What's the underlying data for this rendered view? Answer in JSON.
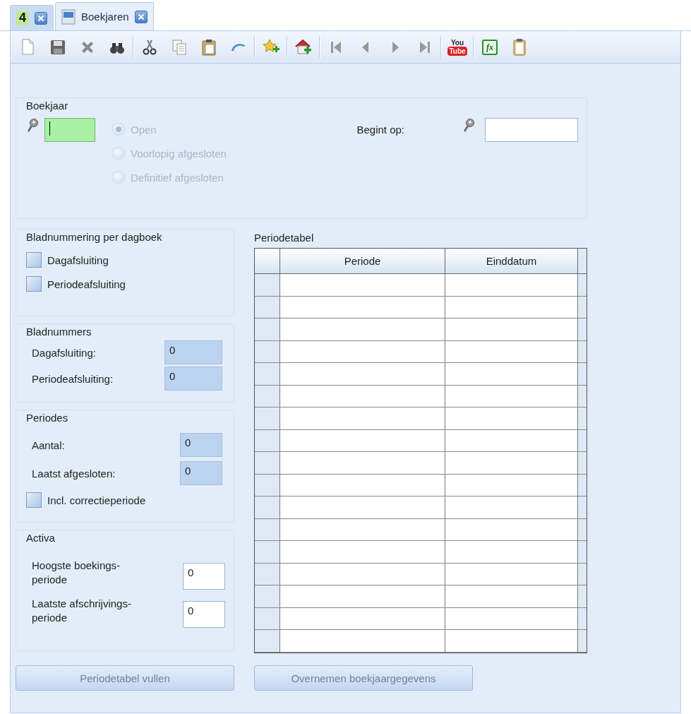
{
  "tabs": [
    {
      "kind": "home",
      "icon_text": "4",
      "selected": false
    },
    {
      "kind": "document",
      "label": "Boekjaren",
      "selected": true
    }
  ],
  "toolbar": [
    {
      "kind": "new"
    },
    {
      "kind": "save"
    },
    {
      "kind": "delete"
    },
    {
      "kind": "find"
    },
    {
      "kind": "separator"
    },
    {
      "kind": "cut"
    },
    {
      "kind": "copy"
    },
    {
      "kind": "paste"
    },
    {
      "kind": "undo"
    },
    {
      "kind": "separator"
    },
    {
      "kind": "favorite"
    },
    {
      "kind": "separator"
    },
    {
      "kind": "home-add"
    },
    {
      "kind": "separator"
    },
    {
      "kind": "first"
    },
    {
      "kind": "previous"
    },
    {
      "kind": "next"
    },
    {
      "kind": "last"
    },
    {
      "kind": "separator"
    },
    {
      "kind": "video",
      "top_text": "You",
      "bottom_text": "Tube"
    },
    {
      "kind": "separator"
    },
    {
      "kind": "spreadsheet",
      "glyph": "fx"
    },
    {
      "kind": "clipboard"
    }
  ],
  "boekjaar": {
    "title": "Boekjaar",
    "year_field": {
      "focused": true
    },
    "status_options": [
      {
        "label": "Open",
        "selected": true,
        "disabled": true
      },
      {
        "label": "Voorlopig afgesloten",
        "selected": false,
        "disabled": true
      },
      {
        "label": "Definitief afgesloten",
        "selected": false,
        "disabled": true
      }
    ],
    "start_label": "Begint op:",
    "start_field": {
      "focused": false
    }
  },
  "bladnummering": {
    "title": "Bladnummering per dagboek",
    "options": [
      {
        "label": "Dagafsluiting",
        "checked": false
      },
      {
        "label": "Periodeafsluiting",
        "checked": false
      }
    ]
  },
  "bladnummers": {
    "title": "Bladnummers",
    "fields": [
      {
        "label": "Dagafsluiting:",
        "value": "0",
        "readonly": true
      },
      {
        "label": "Periodeafsluiting:",
        "value": "0",
        "readonly": true
      }
    ]
  },
  "periodes": {
    "title": "Periodes",
    "fields": [
      {
        "label": "Aantal:",
        "value": "0",
        "readonly": true
      },
      {
        "label": "Laatst afgesloten:",
        "value": "0",
        "readonly": true
      }
    ],
    "option": {
      "label": "Incl. correctieperiode",
      "checked": false
    }
  },
  "activa": {
    "title": "Activa",
    "fields": [
      {
        "label": "Hoogste boekings-\nperiode",
        "value": "0",
        "readonly": false
      },
      {
        "label": "Laatste afschrijvings-\nperiode",
        "value": "0",
        "readonly": false
      }
    ]
  },
  "periodetabel": {
    "title": "Periodetabel",
    "columns": [
      "Periode",
      "Einddatum"
    ]
  },
  "buttons": [
    {
      "label": "Periodetabel vullen",
      "disabled": true
    },
    {
      "label": "Overnemen boekjaargegevens",
      "disabled": true
    }
  ]
}
